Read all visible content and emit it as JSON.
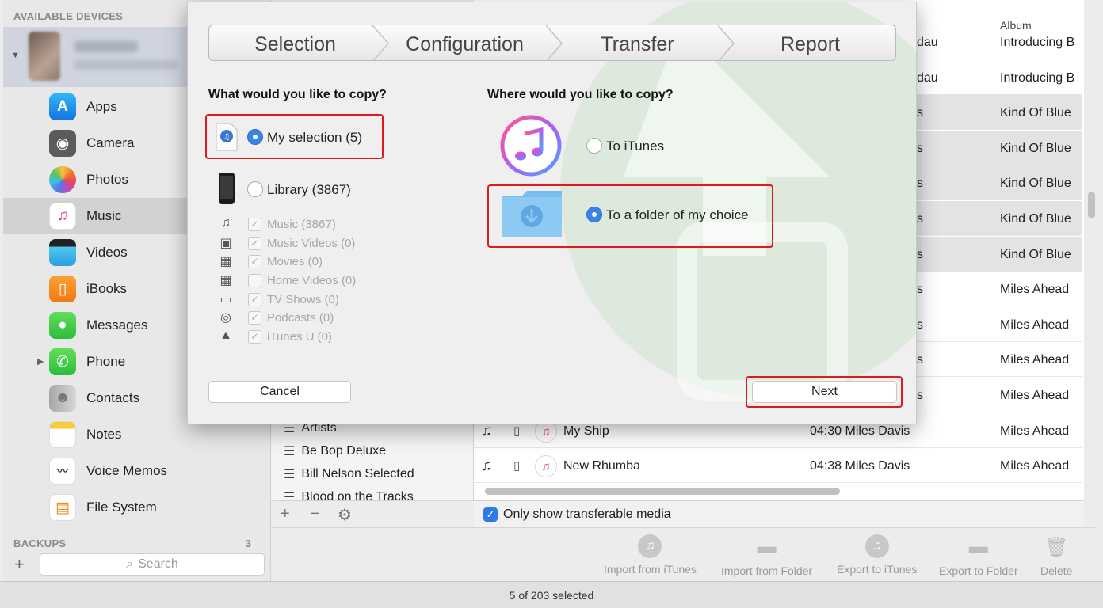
{
  "sidebar": {
    "devices_heading": "AVAILABLE DEVICES",
    "backups_heading": "BACKUPS",
    "backups_count": "3",
    "search_placeholder": "Search",
    "items": [
      {
        "label": "Apps",
        "icon": "app-store-icon"
      },
      {
        "label": "Camera",
        "icon": "camera-icon"
      },
      {
        "label": "Photos",
        "icon": "photos-icon"
      },
      {
        "label": "Music",
        "icon": "music-icon"
      },
      {
        "label": "Videos",
        "icon": "videos-icon"
      },
      {
        "label": "iBooks",
        "icon": "ibooks-icon"
      },
      {
        "label": "Messages",
        "icon": "messages-icon"
      },
      {
        "label": "Phone",
        "icon": "phone-icon"
      },
      {
        "label": "Contacts",
        "icon": "contacts-icon"
      },
      {
        "label": "Notes",
        "icon": "notes-icon"
      },
      {
        "label": "Voice Memos",
        "icon": "voice-memos-icon"
      },
      {
        "label": "File System",
        "icon": "file-system-icon"
      }
    ]
  },
  "playlists": [
    "Artists",
    "Be Bop Deluxe",
    "Bill Nelson Selected",
    "Blood on the Tracks"
  ],
  "tracks": {
    "album_header": "Album",
    "partial_rows": [
      {
        "mid": "dau",
        "album": "Introducing B"
      },
      {
        "mid": "dau",
        "album": "Introducing B"
      },
      {
        "mid": "s",
        "album": "Kind Of Blue"
      },
      {
        "mid": "s",
        "album": "Kind Of Blue"
      },
      {
        "mid": "s",
        "album": "Kind Of Blue"
      },
      {
        "mid": "s",
        "album": "Kind Of Blue"
      },
      {
        "mid": "s",
        "album": "Kind Of Blue"
      },
      {
        "mid": "s",
        "album": "Miles Ahead"
      },
      {
        "mid": "s",
        "album": "Miles Ahead"
      },
      {
        "mid": "s",
        "album": "Miles Ahead"
      },
      {
        "mid": "s",
        "album": "Miles Ahead"
      }
    ],
    "full_rows": [
      {
        "title": "My Ship",
        "meta": "04:30 Miles Davis",
        "album": "Miles Ahead"
      },
      {
        "title": "New Rhumba",
        "meta": "04:38 Miles Davis",
        "album": "Miles Ahead"
      }
    ]
  },
  "filter": {
    "label": "Only show transferable media"
  },
  "actions": [
    "Import from iTunes",
    "Import from Folder",
    "Export to iTunes",
    "Export to Folder",
    "Delete"
  ],
  "status": "5 of 203 selected",
  "modal": {
    "steps": [
      "Selection",
      "Configuration",
      "Transfer",
      "Report"
    ],
    "left_title": "What would you like to copy?",
    "my_selection": "My selection (5)",
    "library": "Library (3867)",
    "sub_items": [
      {
        "label": "Music (3867)",
        "icon": "music-note-icon",
        "checked": true
      },
      {
        "label": "Music Videos (0)",
        "icon": "music-video-icon",
        "checked": true
      },
      {
        "label": "Movies (0)",
        "icon": "film-icon",
        "checked": true
      },
      {
        "label": "Home Videos (0)",
        "icon": "film-icon",
        "checked": false
      },
      {
        "label": "TV Shows (0)",
        "icon": "tv-icon",
        "checked": true
      },
      {
        "label": "Podcasts (0)",
        "icon": "podcast-icon",
        "checked": true
      },
      {
        "label": "iTunes U (0)",
        "icon": "graduation-cap-icon",
        "checked": true
      }
    ],
    "right_title": "Where would you like to copy?",
    "to_itunes": "To iTunes",
    "to_folder": "To a folder of my choice",
    "cancel": "Cancel",
    "next": "Next"
  },
  "colors": {
    "highlight": "#e0191f",
    "accent": "#3b83e8"
  }
}
